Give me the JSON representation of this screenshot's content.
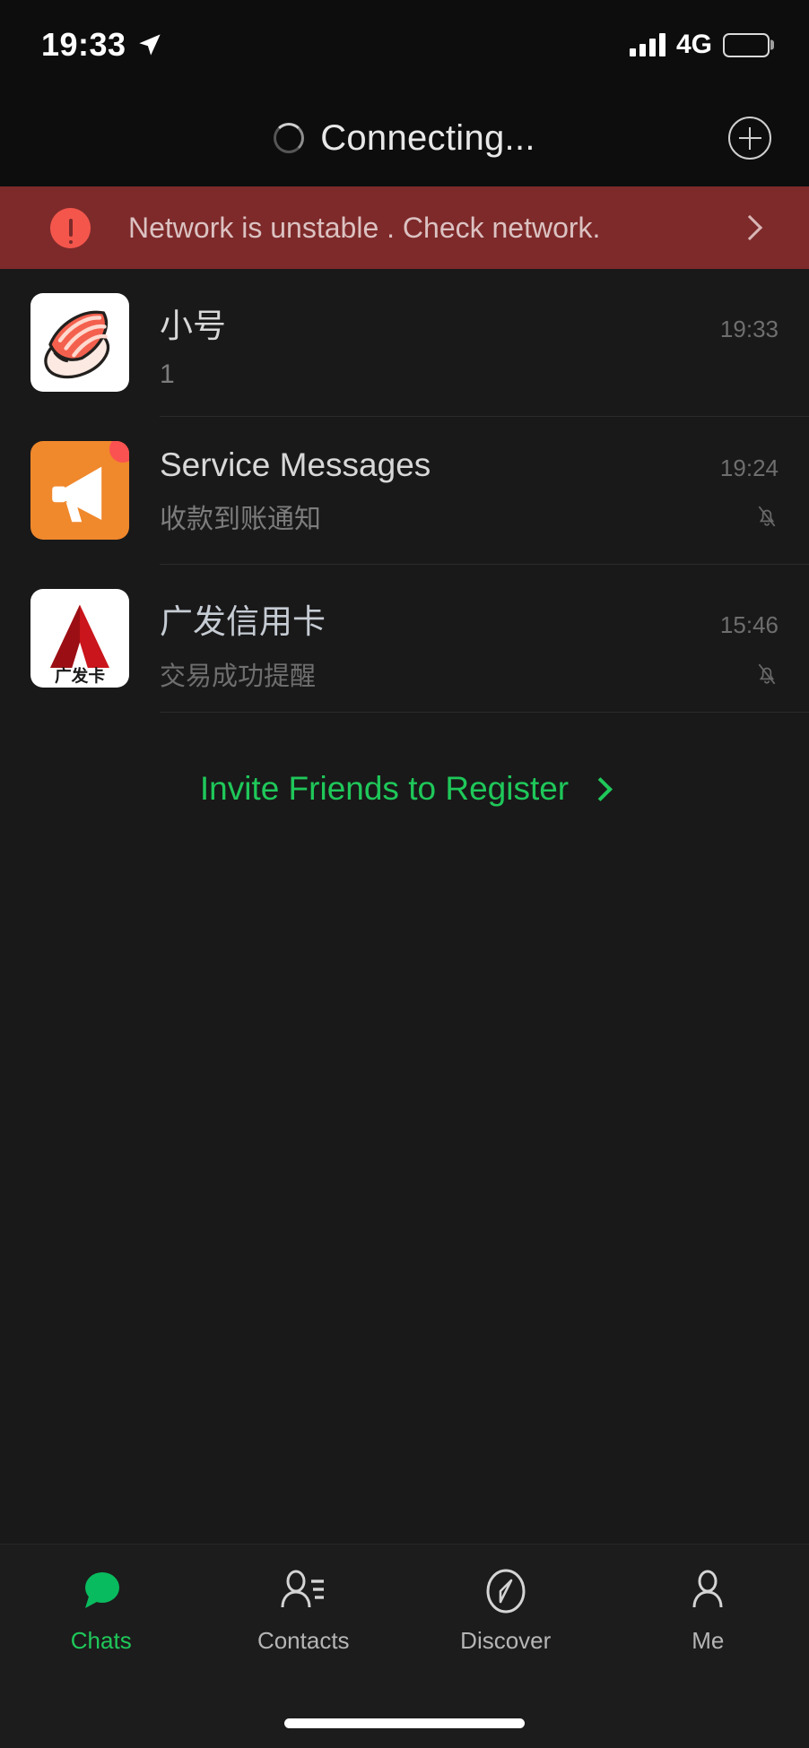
{
  "status_bar": {
    "time": "19:33",
    "location_icon": "location-arrow-icon",
    "signal_icon": "signal-bars-icon",
    "network_type": "4G",
    "battery_icon": "battery-icon"
  },
  "nav_bar": {
    "title": "Connecting...",
    "spinner_icon": "loading-spinner-icon",
    "add_button_icon": "plus-circle-icon"
  },
  "banner": {
    "icon": "error-exclamation-icon",
    "message": "Network is unstable . Check network.",
    "chevron_icon": "chevron-right-icon",
    "background_color": "#7e2a2a",
    "icon_color": "#f4564c"
  },
  "chats": [
    {
      "name": "小号",
      "preview": "1",
      "time": "19:33",
      "avatar_icon": "sushi-nigiri-avatar",
      "muted": false,
      "unread_dot": false
    },
    {
      "name": "Service Messages",
      "preview": "收款到账通知",
      "time": "19:24",
      "avatar_icon": "megaphone-avatar",
      "muted": true,
      "unread_dot": true
    },
    {
      "name": "广发信用卡",
      "preview": "交易成功提醒",
      "time": "15:46",
      "avatar_icon": "cgb-bank-avatar",
      "avatar_caption": "广发卡",
      "muted": true,
      "unread_dot": false
    }
  ],
  "invite": {
    "label": "Invite Friends to Register",
    "chevron_icon": "chevron-right-icon",
    "color": "#1fc85a"
  },
  "tab_bar": {
    "accent_color": "#1fc85a",
    "items": [
      {
        "label": "Chats",
        "icon": "chat-bubble-icon",
        "active": true
      },
      {
        "label": "Contacts",
        "icon": "contacts-person-icon",
        "active": false
      },
      {
        "label": "Discover",
        "icon": "compass-icon",
        "active": false
      },
      {
        "label": "Me",
        "icon": "person-icon",
        "active": false
      }
    ]
  }
}
